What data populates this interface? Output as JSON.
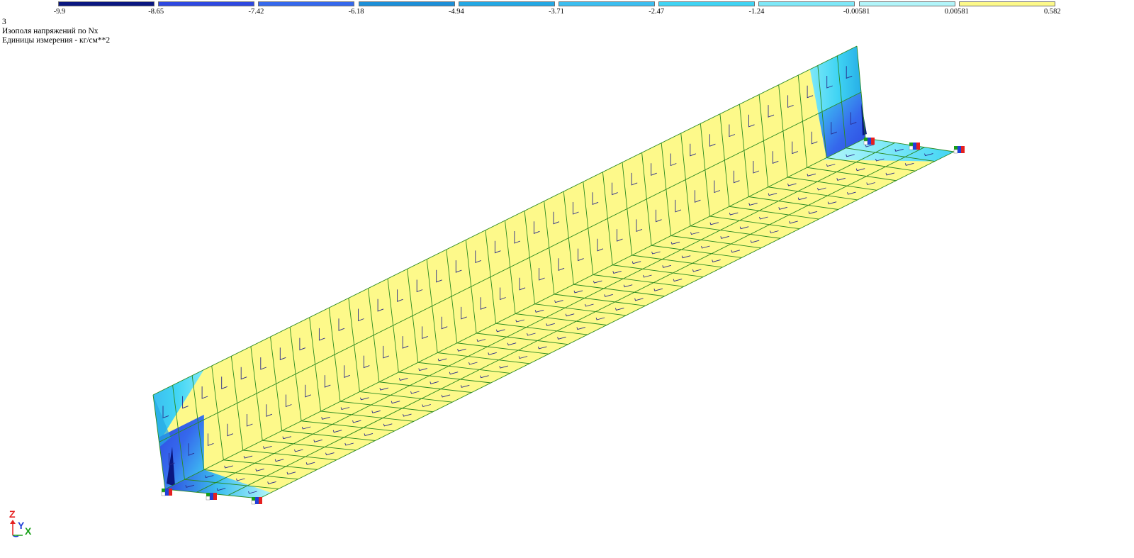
{
  "header": {
    "case_number": "3",
    "title": "Изополя напряжений по Nx",
    "units": "Единицы измерения - кг/см**2"
  },
  "legend": {
    "labels": [
      "-9.9",
      "-8.65",
      "-7.42",
      "-6.18",
      "-4.94",
      "-3.71",
      "-2.47",
      "-1.24",
      "-0.00581",
      "0.00581",
      "0.582"
    ],
    "colors": [
      "#0a1780",
      "#2e48e0",
      "#3568ec",
      "#1c8fd8",
      "#23a8e4",
      "#3cbef0",
      "#40d4f4",
      "#7ee8f8",
      "#b2f5fa",
      "#f4f6ec",
      "#fdf98a"
    ]
  },
  "colors": {
    "element_edge": "#2a8a1f",
    "local_axis": "#2a2a8a",
    "axis_z": "#e52020",
    "axis_y": "#2040d8",
    "axis_x": "#18a018"
  },
  "axes": {
    "z": "Z",
    "y": "Y",
    "x": "X"
  }
}
